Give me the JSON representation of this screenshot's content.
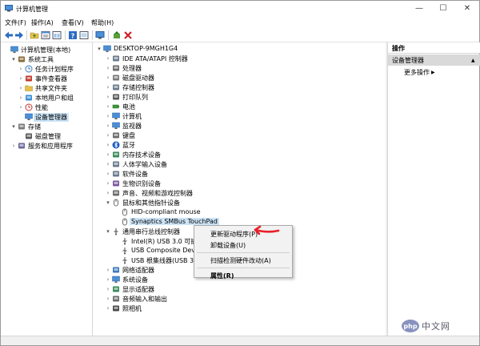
{
  "window": {
    "title": "计算机管理",
    "controls": {
      "minimize": "—",
      "maximize": "☐",
      "close": "✕"
    }
  },
  "menu": [
    "文件(F)",
    "操作(A)",
    "查看(V)",
    "帮助(H)"
  ],
  "toolbar": {
    "icons": [
      "back-arrow-icon",
      "forward-arrow-icon",
      "up-folder-icon",
      "properties-icon",
      "help-icon",
      "console-icon",
      "monitor-icon",
      "update-driver-icon",
      "delete-icon"
    ]
  },
  "left_tree": [
    {
      "label": "计算机管理(本地)",
      "expander": "",
      "icon": "computer-mgmt-icon",
      "depth": 0
    },
    {
      "label": "系统工具",
      "expander": "▾",
      "icon": "tools-icon",
      "depth": 1
    },
    {
      "label": "任务计划程序",
      "expander": "›",
      "icon": "clock-icon",
      "depth": 2
    },
    {
      "label": "事件查看器",
      "expander": "›",
      "icon": "event-viewer-icon",
      "depth": 2
    },
    {
      "label": "共享文件夹",
      "expander": "›",
      "icon": "shared-folder-icon",
      "depth": 2
    },
    {
      "label": "本地用户和组",
      "expander": "›",
      "icon": "users-icon",
      "depth": 2
    },
    {
      "label": "性能",
      "expander": "›",
      "icon": "performance-icon",
      "depth": 2
    },
    {
      "label": "设备管理器",
      "expander": "",
      "icon": "device-manager-icon",
      "depth": 2,
      "selected": true
    },
    {
      "label": "存储",
      "expander": "▾",
      "icon": "storage-icon",
      "depth": 1
    },
    {
      "label": "磁盘管理",
      "expander": "",
      "icon": "disk-icon",
      "depth": 2
    },
    {
      "label": "服务和应用程序",
      "expander": "›",
      "icon": "services-icon",
      "depth": 1
    }
  ],
  "device_tree": [
    {
      "label": "DESKTOP-9MGH1G4",
      "expander": "▾",
      "icon": "computer-icon",
      "depth": 0
    },
    {
      "label": "IDE ATA/ATAPI 控制器",
      "expander": "›",
      "icon": "ide-controller-icon",
      "depth": 1
    },
    {
      "label": "处理器",
      "expander": "›",
      "icon": "processor-icon",
      "depth": 1
    },
    {
      "label": "磁盘驱动器",
      "expander": "›",
      "icon": "disk-drive-icon",
      "depth": 1
    },
    {
      "label": "存储控制器",
      "expander": "›",
      "icon": "storage-controller-icon",
      "depth": 1
    },
    {
      "label": "打印队列",
      "expander": "›",
      "icon": "printer-icon",
      "depth": 1
    },
    {
      "label": "电池",
      "expander": "›",
      "icon": "battery-icon",
      "depth": 1
    },
    {
      "label": "计算机",
      "expander": "›",
      "icon": "computer-icon",
      "depth": 1
    },
    {
      "label": "监视器",
      "expander": "›",
      "icon": "monitor-icon",
      "depth": 1
    },
    {
      "label": "键盘",
      "expander": "›",
      "icon": "keyboard-icon",
      "depth": 1
    },
    {
      "label": "蓝牙",
      "expander": "›",
      "icon": "bluetooth-icon",
      "depth": 1
    },
    {
      "label": "内存技术设备",
      "expander": "›",
      "icon": "memory-icon",
      "depth": 1
    },
    {
      "label": "人体学输入设备",
      "expander": "›",
      "icon": "hid-icon",
      "depth": 1
    },
    {
      "label": "软件设备",
      "expander": "›",
      "icon": "software-device-icon",
      "depth": 1
    },
    {
      "label": "生物识别设备",
      "expander": "›",
      "icon": "biometric-icon",
      "depth": 1
    },
    {
      "label": "声音、视频和游戏控制器",
      "expander": "›",
      "icon": "sound-icon",
      "depth": 1
    },
    {
      "label": "鼠标和其他指针设备",
      "expander": "▾",
      "icon": "mouse-icon",
      "depth": 1
    },
    {
      "label": "HID-compliant mouse",
      "expander": "",
      "icon": "mouse-icon",
      "depth": 2
    },
    {
      "label": "Synaptics SMBus TouchPad",
      "expander": "",
      "icon": "mouse-icon",
      "depth": 2,
      "selected": true
    },
    {
      "label": "通用串行总线控制器",
      "expander": "▾",
      "icon": "usb-icon",
      "depth": 1
    },
    {
      "label": "Intel(R) USB 3.0 可扩",
      "expander": "",
      "icon": "usb-icon",
      "depth": 2
    },
    {
      "label": "USB Composite Devi",
      "expander": "",
      "icon": "usb-icon",
      "depth": 2
    },
    {
      "label": "USB 根集线器(USB 3.",
      "expander": "",
      "icon": "usb-icon",
      "depth": 2
    },
    {
      "label": "网络适配器",
      "expander": "›",
      "icon": "network-icon",
      "depth": 1
    },
    {
      "label": "系统设备",
      "expander": "›",
      "icon": "system-device-icon",
      "depth": 1
    },
    {
      "label": "显示适配器",
      "expander": "›",
      "icon": "display-adapter-icon",
      "depth": 1
    },
    {
      "label": "音频输入和输出",
      "expander": "›",
      "icon": "audio-icon",
      "depth": 1
    },
    {
      "label": "照相机",
      "expander": "›",
      "icon": "camera-icon",
      "depth": 1
    }
  ],
  "actions": {
    "header": "操作",
    "section": "设备管理器",
    "section_arrow": "▲",
    "more": "更多操作",
    "more_arrow": "▶"
  },
  "context_menu": [
    {
      "label": "更新驱动程序(P)"
    },
    {
      "label": "卸载设备(U)"
    },
    {
      "sep": true
    },
    {
      "label": "扫描检测硬件改动(A)"
    },
    {
      "sep": true
    },
    {
      "label": "属性(R)",
      "bold": true
    }
  ],
  "watermark": {
    "text": "php",
    "sub": "中文网"
  },
  "colors": {
    "selection": "#cce4f7",
    "accent": "#2b6cc4",
    "arrow": "#e8202a"
  }
}
